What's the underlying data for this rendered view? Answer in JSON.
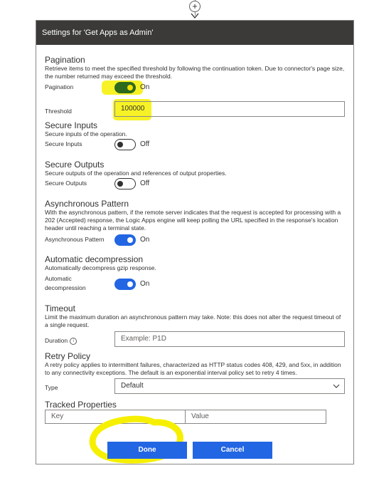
{
  "window": {
    "title": "Settings for 'Get Apps as Admin'"
  },
  "canvas": {
    "add_icon": "plus-icon",
    "arrow_icon": "arrow-down-icon"
  },
  "pagination": {
    "title": "Pagination",
    "description": "Retrieve items to meet the specified threshold by following the continuation token. Due to connector's page size, the number returned may exceed the threshold.",
    "toggle_label": "Pagination",
    "state": "On",
    "threshold_label": "Threshold",
    "threshold_value": "100000"
  },
  "secure_inputs": {
    "title": "Secure Inputs",
    "description": "Secure inputs of the operation.",
    "toggle_label": "Secure Inputs",
    "state": "Off"
  },
  "secure_outputs": {
    "title": "Secure Outputs",
    "description": "Secure outputs of the operation and references of output properties.",
    "toggle_label": "Secure Outputs",
    "state": "Off"
  },
  "async": {
    "title": "Asynchronous Pattern",
    "description": "With the asynchronous pattern, if the remote server indicates that the request is accepted for processing with a 202 (Accepted) response, the Logic Apps engine will keep polling the URL specified in the response's location header until reaching a terminal state.",
    "toggle_label": "Asynchronous Pattern",
    "state": "On"
  },
  "decompression": {
    "title": "Automatic decompression",
    "description": "Automatically decompress gzip response.",
    "toggle_label_1": "Automatic",
    "toggle_label_2": "decompression",
    "state": "On"
  },
  "timeout": {
    "title": "Timeout",
    "description": "Limit the maximum duration an asynchronous pattern may take. Note: this does not alter the request timeout of a single request.",
    "duration_label": "Duration",
    "info_icon": "info-icon",
    "info_glyph": "i",
    "duration_placeholder": "Example: P1D"
  },
  "retry": {
    "title": "Retry Policy",
    "description": "A retry policy applies to intermittent failures, characterized as HTTP status codes 408, 429, and 5xx, in addition to any connectivity exceptions. The default is an exponential interval policy set to retry 4 times.",
    "type_label": "Type",
    "type_value": "Default"
  },
  "tracked": {
    "title": "Tracked Properties",
    "key_placeholder": "Key",
    "value_placeholder": "Value"
  },
  "buttons": {
    "done": "Done",
    "cancel": "Cancel"
  },
  "colors": {
    "accent": "#2266e3",
    "header": "#3b3a39",
    "highlight": "#f6f000",
    "toggle_green": "#2d6a1e"
  }
}
